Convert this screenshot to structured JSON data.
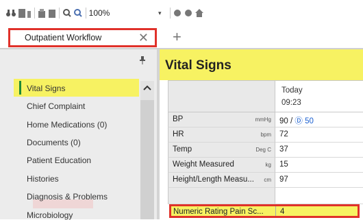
{
  "toolbar": {
    "icons": [
      "binoculars-icon",
      "document-icon",
      "print-icon",
      "print-preview-icon",
      "zoom-out-icon",
      "zoom-in-icon"
    ],
    "zoom": "100%",
    "extra_icons": [
      "circle-icon",
      "circle-icon",
      "home-icon"
    ]
  },
  "tab": {
    "label": "Outpatient Workflow",
    "close": "✕",
    "add": "+"
  },
  "nav": {
    "items": [
      "Vital Signs",
      "Chief Complaint",
      "Home Medications (0)",
      "Documents (0)",
      "Patient Education",
      "Histories",
      "Diagnosis & Problems",
      "Microbiology"
    ],
    "active_index": 0
  },
  "main": {
    "title": "Vital Signs",
    "column": {
      "date": "Today",
      "time": "09:23"
    },
    "rows": [
      {
        "name": "BP",
        "unit": "mmHg",
        "value": "90 / ",
        "extra": "Ⓓ 50"
      },
      {
        "name": "HR",
        "unit": "bpm",
        "value": "72"
      },
      {
        "name": "Temp",
        "unit": "Deg C",
        "value": "37"
      },
      {
        "name": "Weight Measured",
        "unit": "kg",
        "value": "15"
      },
      {
        "name": "Height/Length Measu...",
        "unit": "cm",
        "value": "97"
      }
    ],
    "highlight_row": {
      "name": "Numeric Rating Pain Sc...",
      "value": "4"
    }
  },
  "colors": {
    "highlight": "#f7f262",
    "border_red": "#e0312a",
    "active_bar": "#1f8a37",
    "link": "#1a5fd0"
  }
}
